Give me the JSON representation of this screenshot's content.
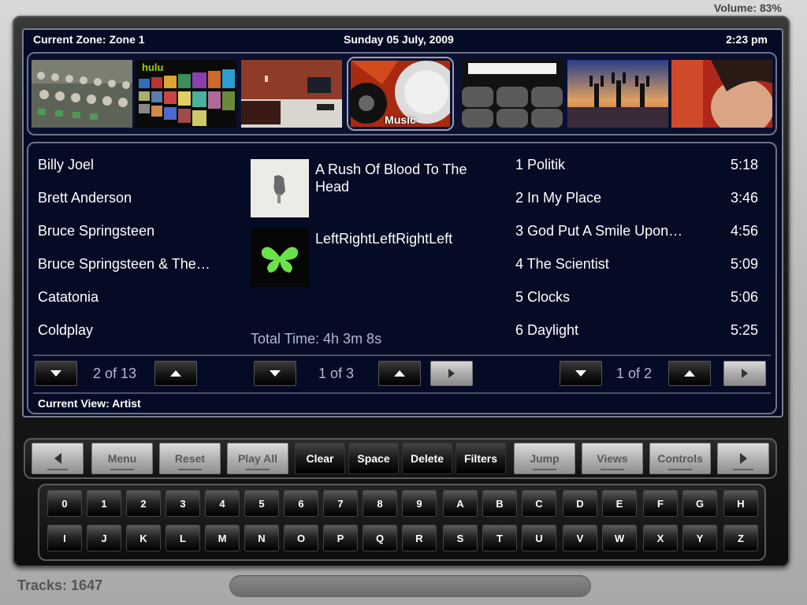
{
  "status": {
    "volume": "Volume: 83%",
    "tracks": "Tracks: 1647"
  },
  "header": {
    "zone": "Current Zone: Zone 1",
    "date": "Sunday 05 July, 2009",
    "time": "2:23 pm"
  },
  "thumbnails": [
    {
      "name": "mixing-console-thumbnail",
      "label": ""
    },
    {
      "name": "hulu-thumbnail",
      "label": "hulu"
    },
    {
      "name": "home-theater-room-thumbnail",
      "label": ""
    },
    {
      "name": "music-thumbnail",
      "label": "Music"
    },
    {
      "name": "cinema-seats-thumbnail",
      "label": ""
    },
    {
      "name": "beach-sunset-thumbnail",
      "label": ""
    },
    {
      "name": "portrait-thumbnail",
      "label": ""
    }
  ],
  "artists": {
    "items": [
      "Billy Joel",
      "Brett Anderson",
      "Bruce Springsteen",
      "Bruce Springsteen & The…",
      "Catatonia",
      "Coldplay"
    ],
    "page": "2 of 13"
  },
  "albums": {
    "items": [
      "A Rush Of Blood To The Head",
      "LeftRightLeftRightLeft"
    ],
    "page": "1 of 3",
    "total_time": "Total Time: 4h 3m 8s"
  },
  "tracks": {
    "items": [
      {
        "name": "1 Politik",
        "duration": "5:18"
      },
      {
        "name": "2 In My Place",
        "duration": "3:46"
      },
      {
        "name": "3 God Put A Smile Upon…",
        "duration": "4:56"
      },
      {
        "name": "4 The Scientist",
        "duration": "5:09"
      },
      {
        "name": "5 Clocks",
        "duration": "5:06"
      },
      {
        "name": "6 Daylight",
        "duration": "5:25"
      }
    ],
    "page": "1 of 2"
  },
  "current_view": "Current View: Artist",
  "toolbar": {
    "menu": "Menu",
    "reset": "Reset",
    "play_all": "Play All",
    "clear": "Clear",
    "space": "Space",
    "delete": "Delete",
    "filters": "Filters",
    "jump": "Jump",
    "views": "Views",
    "controls": "Controls"
  },
  "keyboard": {
    "row1": [
      "0",
      "1",
      "2",
      "3",
      "4",
      "5",
      "6",
      "7",
      "8",
      "9",
      "A",
      "B",
      "C",
      "D",
      "E",
      "F",
      "G",
      "H"
    ],
    "row2": [
      "I",
      "J",
      "K",
      "L",
      "M",
      "N",
      "O",
      "P",
      "Q",
      "R",
      "S",
      "T",
      "U",
      "V",
      "W",
      "X",
      "Y",
      "Z"
    ]
  },
  "colors": {
    "screen_bg": "#050b24",
    "accent_text": "#aeb8d8"
  }
}
